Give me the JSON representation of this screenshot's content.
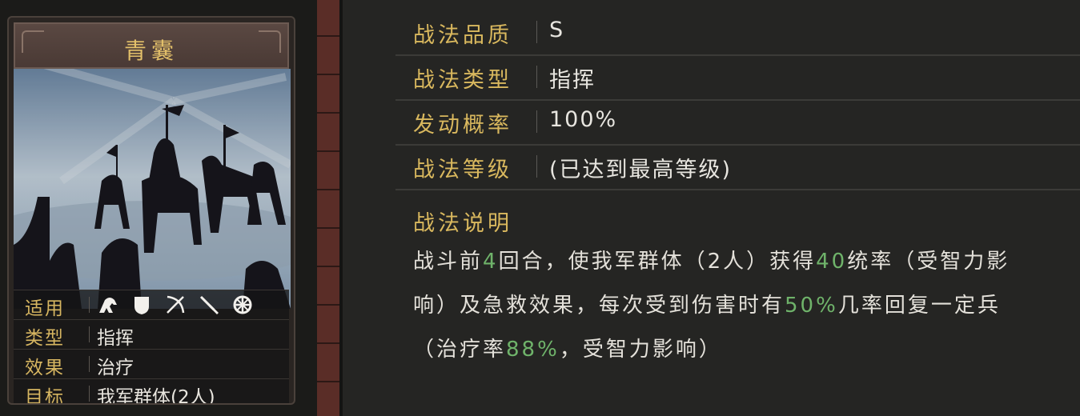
{
  "card": {
    "title": "青囊",
    "rows": [
      {
        "key": "适用",
        "icons": [
          "cavalry-icon",
          "shield-icon",
          "archer-icon",
          "spear-icon",
          "siege-icon"
        ]
      },
      {
        "key": "类型",
        "value": "指挥"
      },
      {
        "key": "效果",
        "value": "治疗"
      },
      {
        "key": "目标",
        "value": "我军群体(2人)"
      }
    ]
  },
  "props": [
    {
      "label": "战法品质",
      "value": "S"
    },
    {
      "label": "战法类型",
      "value": "指挥"
    },
    {
      "label": "发动概率",
      "value": "100%"
    },
    {
      "label": "战法等级",
      "value": "(已达到最高等级)"
    }
  ],
  "description": {
    "title": "战法说明",
    "line1": {
      "a": "战斗前",
      "n1": "4",
      "b": "回合，使我军群体（2人）获得",
      "n2": "40",
      "c": "统率（受智力影"
    },
    "line2": {
      "a": "响）及急救效果，每次受到伤害时有",
      "n1": "50%",
      "b": "几率回复一定兵"
    },
    "line3": {
      "a": "（治疗率",
      "n1": "88%",
      "b": "，受智力影响）"
    }
  },
  "colors": {
    "accent_gold": "#d9b85e",
    "highlight_green": "#6fb36a",
    "text": "#e8e6e0"
  }
}
